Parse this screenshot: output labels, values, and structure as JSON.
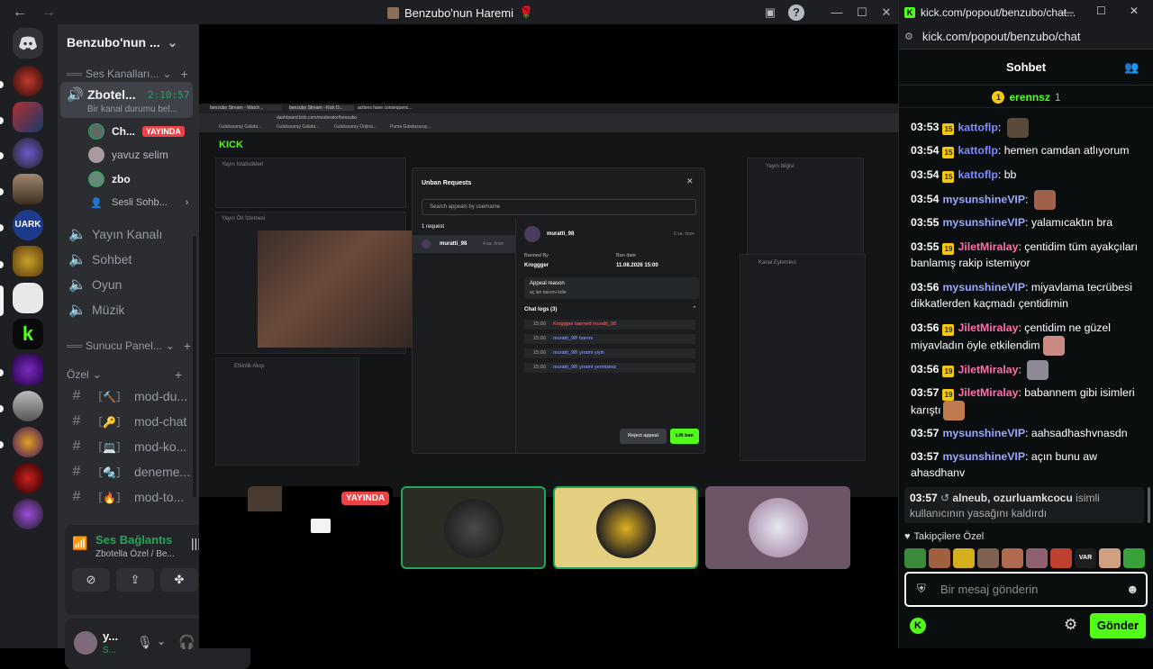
{
  "discord": {
    "window_title": "Benzubo'nun Haremi",
    "guild_name": "Benzubo'nun ...",
    "categories": {
      "voice": "Ses Kanalları...",
      "panel": "Sunucu Panel...",
      "private": "Özel"
    },
    "voice_channel": {
      "name": "Zbotel...",
      "timer": "2:10:57",
      "status": "Bir kanal durumu bel..."
    },
    "voice_users": [
      {
        "name": "Ch...",
        "badge": "YAYINDA"
      },
      {
        "name": "yavuz selim",
        "badge": ""
      },
      {
        "name": "zbo",
        "badge": ""
      },
      {
        "name": "Sesli Sohb...",
        "badge": ""
      }
    ],
    "channels": [
      "Yayın Kanalı",
      "Sohbet",
      "Oyun",
      "Müzik"
    ],
    "text_channels": [
      "mod-du...",
      "mod-chat",
      "mod-ko...",
      "deneme...",
      "mod-to..."
    ],
    "voice_status": {
      "title": "Ses Bağlantısı K",
      "subtitle": "Zbotella Özel / Be..."
    },
    "user": {
      "name": "y...",
      "status": "S..."
    },
    "live_badge": "YAYINDA"
  },
  "stream": {
    "browser_tabs": [
      "benzubo Stream - Watch...",
      "benzubo Stream - Kick D...",
      "actions have consequenc..."
    ],
    "browser_url": "dashboard.kick.com/moderator/benzubo",
    "bookmarks": [
      "Galatasaray Galata...",
      "Galatasaray Galata...",
      "Galatasaray Orijina...",
      "Puma Galatasaray..."
    ],
    "panels": {
      "stats": "Yayın İstatistikleri",
      "preview": "Yayın Ön İzlemesi",
      "info": "Yayın bilgisi",
      "activity": "Etkinlik Akışı",
      "channel_actions": "Kanal Eylemleri"
    },
    "modal": {
      "title": "Unban Requests",
      "search_placeholder": "Search appeals by username",
      "count": "1 request",
      "username": "muratti_98",
      "time": "4 sa. önce",
      "time_detail": "5 sa. önce",
      "banned_by_label": "Banned By",
      "banned_by": "Kroggger",
      "ban_date_label": "Ban date",
      "ban_date": "11.08.2026 15:00",
      "appeal_label": "Appeal reason",
      "appeal": "aç lan banımı kdle",
      "chat_logs_label": "Chat logs (3)",
      "logs": [
        {
          "time": "15:00",
          "text": "Kroggger banned muratti_98"
        },
        {
          "time": "15:00",
          "text": "muratti_98! banını"
        },
        {
          "time": "15:00",
          "text": "muratti_98! yrrami yiyin"
        },
        {
          "time": "15:00",
          "text": "muratti_98! yrrami yermisiniz"
        }
      ],
      "reject": "Reject appeal",
      "lift": "Lift ban"
    }
  },
  "kick": {
    "tab_title": "kick.com/popout/benzubo/chat...",
    "url": "kick.com/popout/benzubo/chat",
    "header": "Sohbet",
    "pinned": {
      "rank": "1",
      "name": "erennsz",
      "count": "1"
    },
    "messages": [
      {
        "time": "03:53",
        "badge": "15",
        "user": "kattoflp",
        "color": "#7f8cff",
        "text": "",
        "emote": "#5a4a3a"
      },
      {
        "time": "03:54",
        "badge": "15",
        "user": "kattoflp",
        "color": "#7f8cff",
        "text": "hemen camdan atlıyorum",
        "emote": ""
      },
      {
        "time": "03:54",
        "badge": "15",
        "user": "kattoflp",
        "color": "#7f8cff",
        "text": "bb",
        "emote": ""
      },
      {
        "time": "03:54",
        "badge": "",
        "user": "mysunshineVIP",
        "color": "#9aa8ff",
        "text": "",
        "emote": "#a0614a"
      },
      {
        "time": "03:55",
        "badge": "",
        "user": "mysunshineVIP",
        "color": "#9aa8ff",
        "text": "yalamıcaktın bra",
        "emote": ""
      },
      {
        "time": "03:55",
        "badge": "19",
        "user": "JiletMiralay",
        "color": "#ff6fa8",
        "text": "çentidim tüm ayakçıları banlamış rakip istemiyor",
        "emote": ""
      },
      {
        "time": "03:56",
        "badge": "",
        "user": "mysunshineVIP",
        "color": "#9aa8ff",
        "text": "miyavlama tecrübesi dikkatlerden kaçmadı çentidimin",
        "emote": ""
      },
      {
        "time": "03:56",
        "badge": "19",
        "user": "JiletMiralay",
        "color": "#ff6fa8",
        "text": "çentidim ne güzel miyavladın öyle etkilendim",
        "emote": "#c98a84"
      },
      {
        "time": "03:56",
        "badge": "19",
        "user": "JiletMiralay",
        "color": "#ff6fa8",
        "text": "",
        "emote": "#8d8a93"
      },
      {
        "time": "03:57",
        "badge": "19",
        "user": "JiletMiralay",
        "color": "#ff6fa8",
        "text": "babannem gibi isimleri karıştı",
        "emote": "#c07a50"
      },
      {
        "time": "03:57",
        "badge": "",
        "user": "mysunshineVIP",
        "color": "#9aa8ff",
        "text": "aahsadhashvnasdn",
        "emote": ""
      },
      {
        "time": "03:57",
        "badge": "",
        "user": "mysunshineVIP",
        "color": "#9aa8ff",
        "text": "açın bunu aw ahasdhanv",
        "emote": ""
      }
    ],
    "system_message": {
      "time": "03:57",
      "users": "alneub, ozurluamkcocu",
      "text": "isimli kullanıcının yasağını kaldırdı"
    },
    "emote_section": "Takipçilere Özel",
    "input_placeholder": "Bir mesaj gönderin",
    "send_label": "Gönder"
  },
  "colors": {
    "kick_green": "#53fc18",
    "discord_green": "#23a55a",
    "live_red": "#ed4245"
  }
}
